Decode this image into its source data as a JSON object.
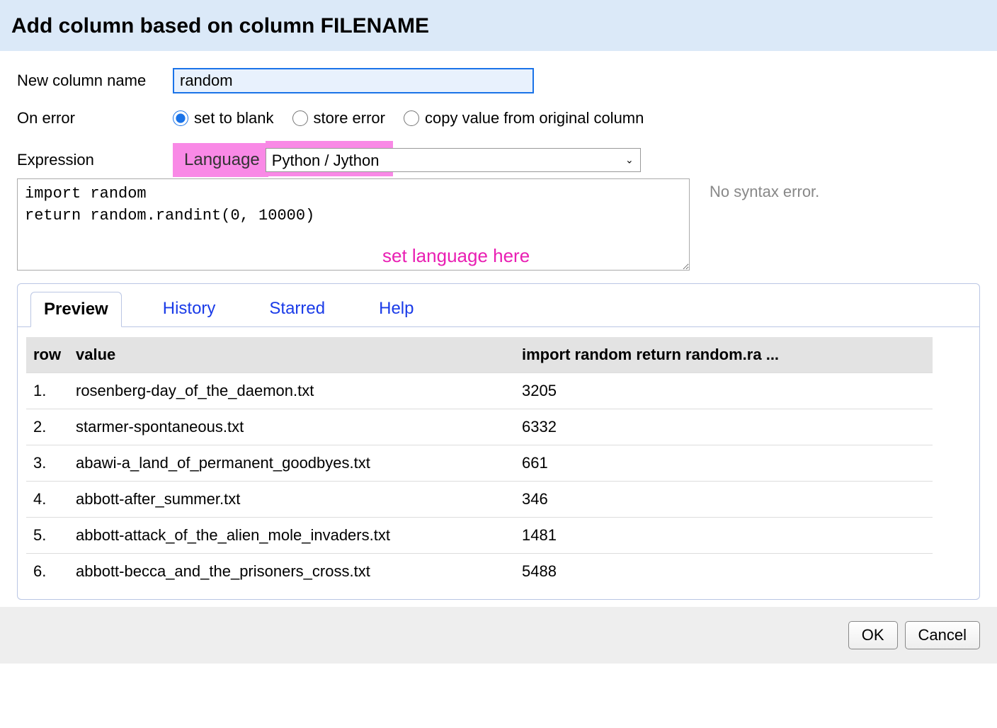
{
  "dialog": {
    "title": "Add column based on column FILENAME"
  },
  "form": {
    "column_name_label": "New column name",
    "column_name_value": "random",
    "on_error_label": "On error",
    "on_error_options": {
      "blank": "set to blank",
      "store": "store error",
      "copy": "copy value from original column"
    },
    "expression_label": "Expression",
    "language_label": "Language",
    "language_value": "Python / Jython",
    "expression_value": "import random\nreturn random.randint(0, 10000)",
    "syntax_status": "No syntax error.",
    "annotation": "set language here"
  },
  "tabs": {
    "preview": "Preview",
    "history": "History",
    "starred": "Starred",
    "help": "Help"
  },
  "preview": {
    "headers": {
      "row": "row",
      "value": "value",
      "result": "import random return random.ra ..."
    },
    "rows": [
      {
        "n": "1.",
        "value": "rosenberg-day_of_the_daemon.txt",
        "result": "3205"
      },
      {
        "n": "2.",
        "value": "starmer-spontaneous.txt",
        "result": "6332"
      },
      {
        "n": "3.",
        "value": "abawi-a_land_of_permanent_goodbyes.txt",
        "result": "661"
      },
      {
        "n": "4.",
        "value": "abbott-after_summer.txt",
        "result": "346"
      },
      {
        "n": "5.",
        "value": "abbott-attack_of_the_alien_mole_invaders.txt",
        "result": "1481"
      },
      {
        "n": "6.",
        "value": "abbott-becca_and_the_prisoners_cross.txt",
        "result": "5488"
      }
    ]
  },
  "footer": {
    "ok": "OK",
    "cancel": "Cancel"
  }
}
